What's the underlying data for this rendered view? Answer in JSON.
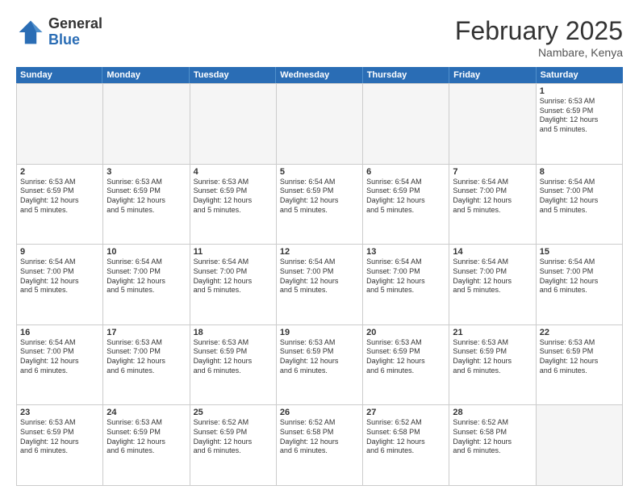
{
  "logo": {
    "general": "General",
    "blue": "Blue"
  },
  "title": "February 2025",
  "location": "Nambare, Kenya",
  "days_header": [
    "Sunday",
    "Monday",
    "Tuesday",
    "Wednesday",
    "Thursday",
    "Friday",
    "Saturday"
  ],
  "weeks": [
    [
      {
        "day": "",
        "info": "",
        "empty": true
      },
      {
        "day": "",
        "info": "",
        "empty": true
      },
      {
        "day": "",
        "info": "",
        "empty": true
      },
      {
        "day": "",
        "info": "",
        "empty": true
      },
      {
        "day": "",
        "info": "",
        "empty": true
      },
      {
        "day": "",
        "info": "",
        "empty": true
      },
      {
        "day": "1",
        "info": "Sunrise: 6:53 AM\nSunset: 6:59 PM\nDaylight: 12 hours\nand 5 minutes.",
        "empty": false
      }
    ],
    [
      {
        "day": "2",
        "info": "Sunrise: 6:53 AM\nSunset: 6:59 PM\nDaylight: 12 hours\nand 5 minutes.",
        "empty": false
      },
      {
        "day": "3",
        "info": "Sunrise: 6:53 AM\nSunset: 6:59 PM\nDaylight: 12 hours\nand 5 minutes.",
        "empty": false
      },
      {
        "day": "4",
        "info": "Sunrise: 6:53 AM\nSunset: 6:59 PM\nDaylight: 12 hours\nand 5 minutes.",
        "empty": false
      },
      {
        "day": "5",
        "info": "Sunrise: 6:54 AM\nSunset: 6:59 PM\nDaylight: 12 hours\nand 5 minutes.",
        "empty": false
      },
      {
        "day": "6",
        "info": "Sunrise: 6:54 AM\nSunset: 6:59 PM\nDaylight: 12 hours\nand 5 minutes.",
        "empty": false
      },
      {
        "day": "7",
        "info": "Sunrise: 6:54 AM\nSunset: 7:00 PM\nDaylight: 12 hours\nand 5 minutes.",
        "empty": false
      },
      {
        "day": "8",
        "info": "Sunrise: 6:54 AM\nSunset: 7:00 PM\nDaylight: 12 hours\nand 5 minutes.",
        "empty": false
      }
    ],
    [
      {
        "day": "9",
        "info": "Sunrise: 6:54 AM\nSunset: 7:00 PM\nDaylight: 12 hours\nand 5 minutes.",
        "empty": false
      },
      {
        "day": "10",
        "info": "Sunrise: 6:54 AM\nSunset: 7:00 PM\nDaylight: 12 hours\nand 5 minutes.",
        "empty": false
      },
      {
        "day": "11",
        "info": "Sunrise: 6:54 AM\nSunset: 7:00 PM\nDaylight: 12 hours\nand 5 minutes.",
        "empty": false
      },
      {
        "day": "12",
        "info": "Sunrise: 6:54 AM\nSunset: 7:00 PM\nDaylight: 12 hours\nand 5 minutes.",
        "empty": false
      },
      {
        "day": "13",
        "info": "Sunrise: 6:54 AM\nSunset: 7:00 PM\nDaylight: 12 hours\nand 5 minutes.",
        "empty": false
      },
      {
        "day": "14",
        "info": "Sunrise: 6:54 AM\nSunset: 7:00 PM\nDaylight: 12 hours\nand 5 minutes.",
        "empty": false
      },
      {
        "day": "15",
        "info": "Sunrise: 6:54 AM\nSunset: 7:00 PM\nDaylight: 12 hours\nand 6 minutes.",
        "empty": false
      }
    ],
    [
      {
        "day": "16",
        "info": "Sunrise: 6:54 AM\nSunset: 7:00 PM\nDaylight: 12 hours\nand 6 minutes.",
        "empty": false
      },
      {
        "day": "17",
        "info": "Sunrise: 6:53 AM\nSunset: 7:00 PM\nDaylight: 12 hours\nand 6 minutes.",
        "empty": false
      },
      {
        "day": "18",
        "info": "Sunrise: 6:53 AM\nSunset: 6:59 PM\nDaylight: 12 hours\nand 6 minutes.",
        "empty": false
      },
      {
        "day": "19",
        "info": "Sunrise: 6:53 AM\nSunset: 6:59 PM\nDaylight: 12 hours\nand 6 minutes.",
        "empty": false
      },
      {
        "day": "20",
        "info": "Sunrise: 6:53 AM\nSunset: 6:59 PM\nDaylight: 12 hours\nand 6 minutes.",
        "empty": false
      },
      {
        "day": "21",
        "info": "Sunrise: 6:53 AM\nSunset: 6:59 PM\nDaylight: 12 hours\nand 6 minutes.",
        "empty": false
      },
      {
        "day": "22",
        "info": "Sunrise: 6:53 AM\nSunset: 6:59 PM\nDaylight: 12 hours\nand 6 minutes.",
        "empty": false
      }
    ],
    [
      {
        "day": "23",
        "info": "Sunrise: 6:53 AM\nSunset: 6:59 PM\nDaylight: 12 hours\nand 6 minutes.",
        "empty": false
      },
      {
        "day": "24",
        "info": "Sunrise: 6:53 AM\nSunset: 6:59 PM\nDaylight: 12 hours\nand 6 minutes.",
        "empty": false
      },
      {
        "day": "25",
        "info": "Sunrise: 6:52 AM\nSunset: 6:59 PM\nDaylight: 12 hours\nand 6 minutes.",
        "empty": false
      },
      {
        "day": "26",
        "info": "Sunrise: 6:52 AM\nSunset: 6:58 PM\nDaylight: 12 hours\nand 6 minutes.",
        "empty": false
      },
      {
        "day": "27",
        "info": "Sunrise: 6:52 AM\nSunset: 6:58 PM\nDaylight: 12 hours\nand 6 minutes.",
        "empty": false
      },
      {
        "day": "28",
        "info": "Sunrise: 6:52 AM\nSunset: 6:58 PM\nDaylight: 12 hours\nand 6 minutes.",
        "empty": false
      },
      {
        "day": "",
        "info": "",
        "empty": true
      }
    ]
  ]
}
